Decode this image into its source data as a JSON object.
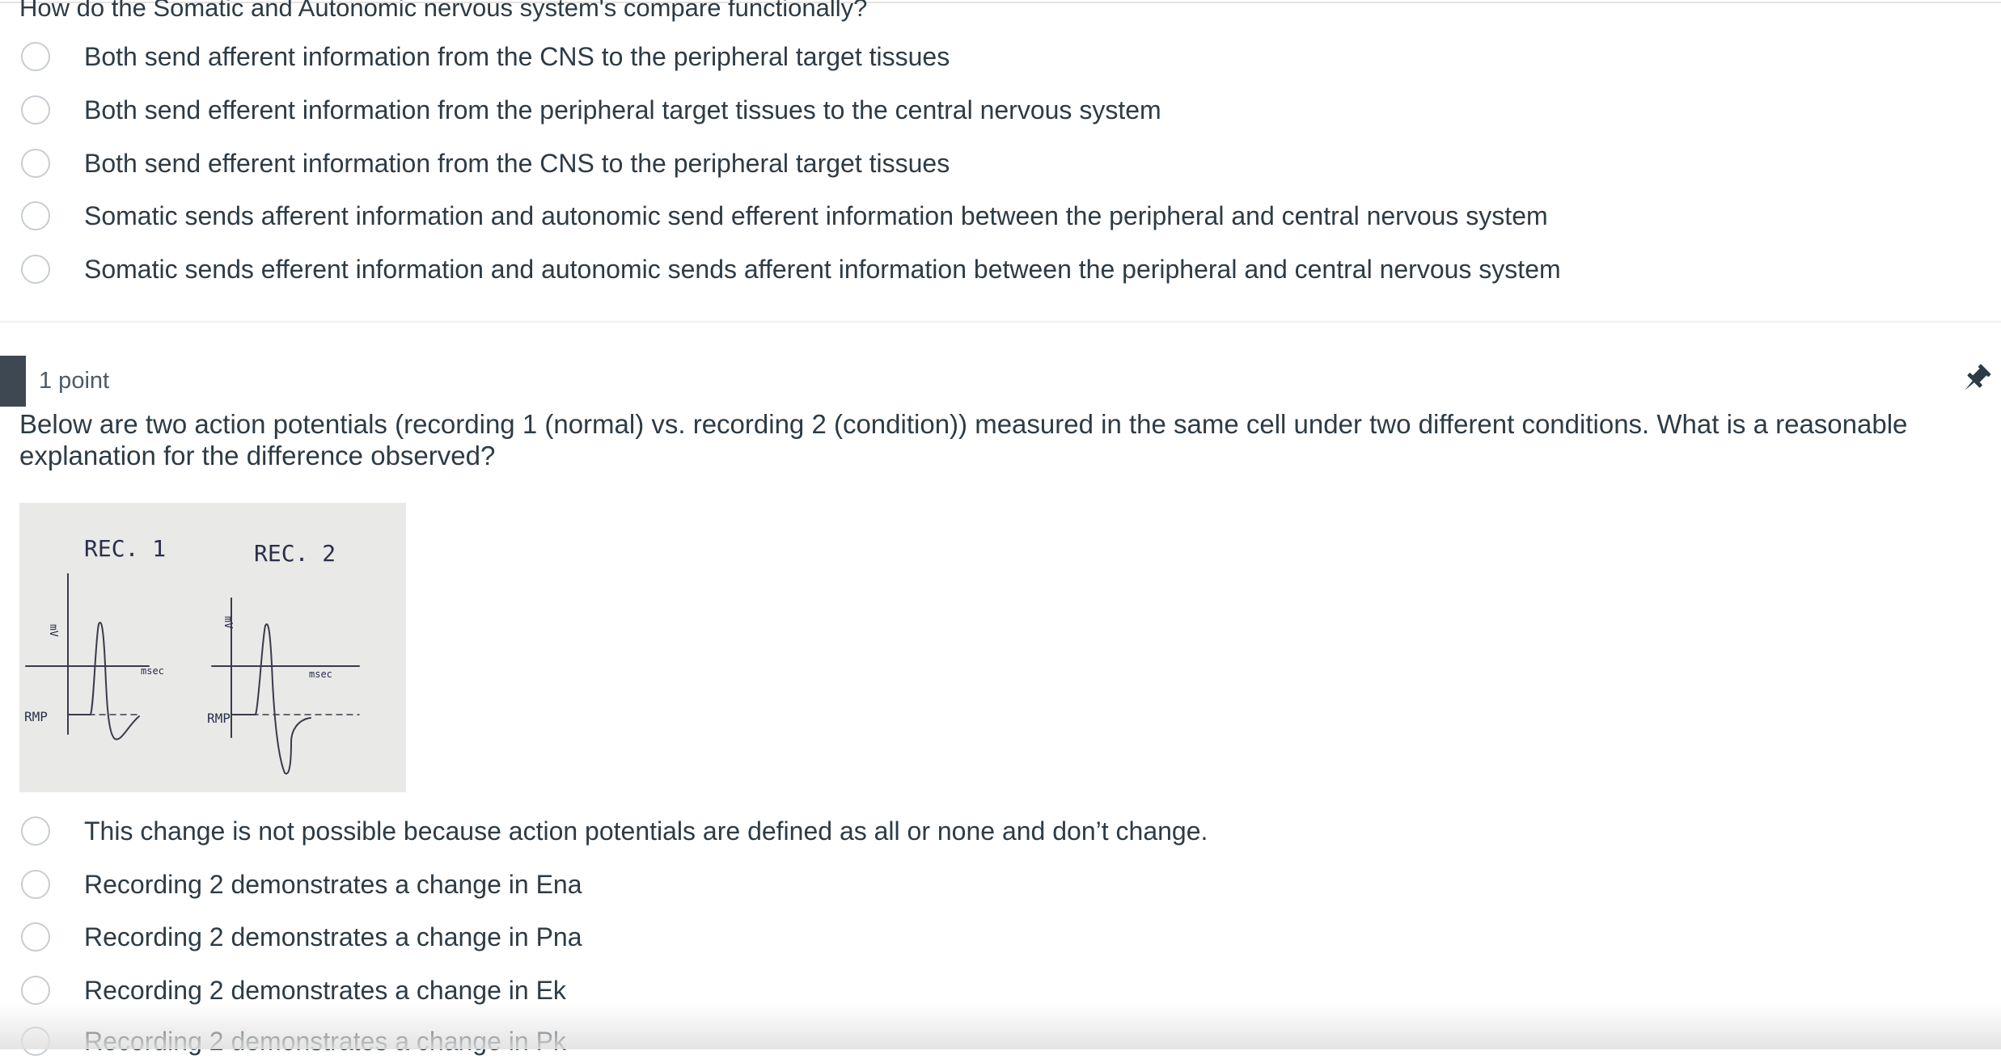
{
  "question1": {
    "text": "How do the Somatic and Autonomic nervous system's compare functionally?",
    "answers": [
      "Both send afferent information from the CNS to the peripheral target tissues",
      "Both send efferent information from the peripheral target tissues to the central nervous system",
      "Both send efferent information from the CNS to the peripheral target tissues",
      "Somatic sends afferent information and autonomic send efferent information between the peripheral and central nervous system",
      "Somatic sends efferent information and autonomic sends afferent information between the peripheral and central nervous system"
    ]
  },
  "question2": {
    "points": "1 point",
    "text": "Below are two action potentials (recording 1 (normal) vs. recording 2 (condition)) measured in the same cell under two different conditions. What is a reasonable explanation for the difference observed?",
    "figure": {
      "rec1_label": "REC. 1",
      "rec2_label": "REC. 2",
      "y_axis_label": "mV",
      "x_axis_label": "msec",
      "baseline_label": "RMP"
    },
    "answers": [
      "This change is not possible because action potentials are defined as all or none and don’t change.",
      "Recording 2 demonstrates a change in Ena",
      "Recording 2 demonstrates a change in Pna",
      "Recording 2 demonstrates a change in Ek",
      "Recording 2 demonstrates a change in Pk"
    ]
  },
  "icons": {
    "radio": "radio-button-icon",
    "pin": "pin-icon"
  },
  "colors": {
    "text": "#2d3b45",
    "radio_border": "#c7cdd1",
    "tab": "#3d4852"
  }
}
